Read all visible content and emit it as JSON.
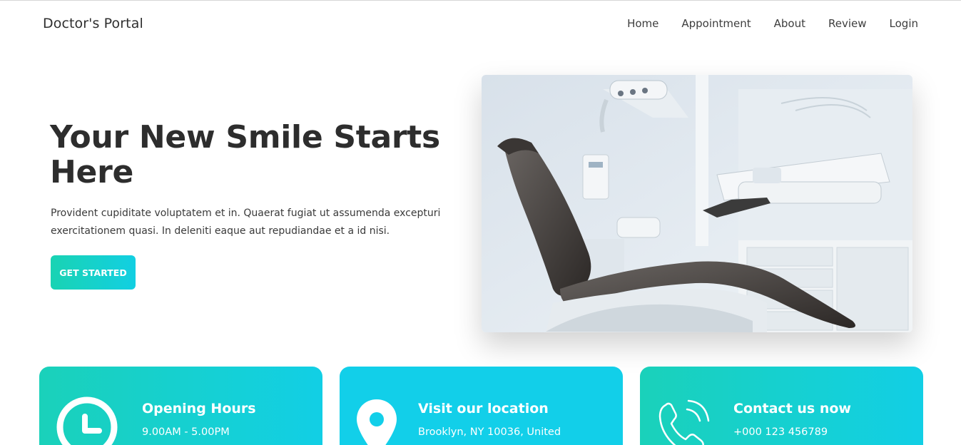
{
  "brand": "Doctor's Portal",
  "nav": {
    "items": [
      "Home",
      "Appointment",
      "About",
      "Review",
      "Login"
    ]
  },
  "hero": {
    "title": "Your New Smile Starts Here",
    "text": "Provident cupiditate voluptatem et in. Quaerat fugiat ut assumenda excepturi exercitationem quasi. In deleniti eaque aut repudiandae et a id nisi.",
    "cta_label": "GET STARTED",
    "image_icon": "dental-chair-photo"
  },
  "info_cards": [
    {
      "icon": "clock-icon",
      "title": "Opening Hours",
      "subtitle": "9.00AM - 5.00PM"
    },
    {
      "icon": "location-pin-icon",
      "title": "Visit our location",
      "subtitle": "Brooklyn, NY 10036, United"
    },
    {
      "icon": "phone-icon",
      "title": "Contact us now",
      "subtitle": "+000 123 456789"
    }
  ],
  "colors": {
    "accent_start": "#19d3b3",
    "accent_end": "#12cfe2",
    "heading": "#2d2d2d",
    "text": "#3a3a3a"
  }
}
